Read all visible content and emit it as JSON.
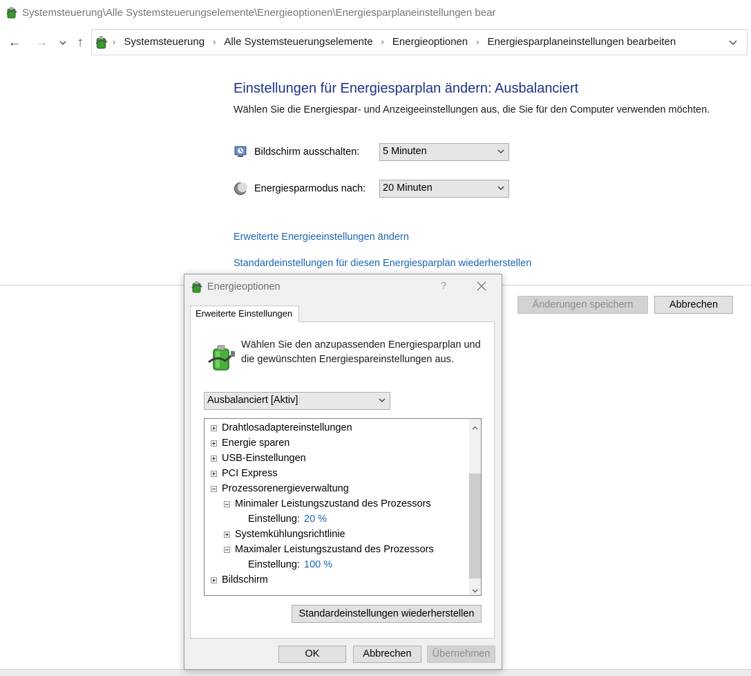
{
  "window": {
    "title": "Systemsteuerung\\Alle Systemsteuerungselemente\\Energieoptionen\\Energiesparplaneinstellungen bear"
  },
  "nav": {
    "back_icon": "arrow-left-icon",
    "forward_icon": "arrow-right-icon",
    "recent_icon": "chevron-down-icon",
    "up_icon": "arrow-up-icon"
  },
  "breadcrumb": [
    "Systemsteuerung",
    "Alle Systemsteuerungselemente",
    "Energieoptionen",
    "Energiesparplaneinstellungen bearbeiten"
  ],
  "main": {
    "heading": "Einstellungen für Energiesparplan ändern: Ausbalanciert",
    "subtitle": "Wählen Sie die Energiespar- und Anzeigeeinstellungen aus, die Sie für den Computer verwenden möchten.",
    "display_off": {
      "label": "Bildschirm ausschalten:",
      "value": "5 Minuten"
    },
    "sleep": {
      "label": "Energiesparmodus nach:",
      "value": "20 Minuten"
    },
    "link_advanced": "Erweiterte Energieeinstellungen ändern",
    "link_restore": "Standardeinstellungen für diesen Energiesparplan wiederherstellen",
    "save_label": "Änderungen speichern",
    "cancel_label": "Abbrechen"
  },
  "dialog": {
    "title": "Energieoptionen",
    "help": "?",
    "tab_label": "Erweiterte Einstellungen",
    "intro": "Wählen Sie den anzupassenden Energiesparplan und die gewünschten Energiespareinstellungen aus.",
    "plan": "Ausbalanciert [Aktiv]",
    "tree": {
      "wireless": "Drahtlosadaptereinstellungen",
      "sleep": "Energie sparen",
      "usb": "USB-Einstellungen",
      "pci": "PCI Express",
      "processor": "Prozessorenergieverwaltung",
      "min_state": "Minimaler Leistungszustand des Prozessors",
      "min_setting_label": "Einstellung:",
      "min_setting_value": "20 %",
      "cooling": "Systemkühlungsrichtlinie",
      "max_state": "Maximaler Leistungszustand des Prozessors",
      "max_setting_label": "Einstellung:",
      "max_setting_value": "100 %",
      "display": "Bildschirm"
    },
    "restore_label": "Standardeinstellungen wiederherstellen",
    "ok_label": "OK",
    "cancel_label": "Abbrechen",
    "apply_label": "Übernehmen"
  },
  "colors": {
    "heading": "#1e3287",
    "link": "#1b66b0"
  }
}
